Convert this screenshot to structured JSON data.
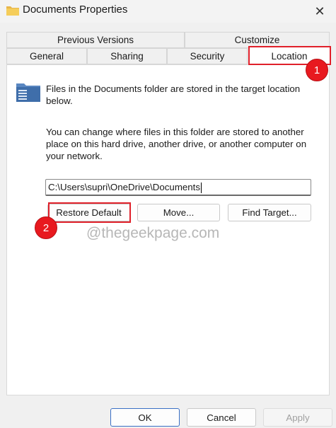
{
  "window": {
    "title": "Documents Properties",
    "close_glyph": "✕",
    "title_icon": "folder-icon"
  },
  "tabs": {
    "row_top": [
      {
        "label": "Previous Versions"
      },
      {
        "label": "Customize"
      }
    ],
    "row_bottom": [
      {
        "label": "General"
      },
      {
        "label": "Sharing"
      },
      {
        "label": "Security"
      },
      {
        "label": "Location",
        "selected": true
      }
    ]
  },
  "location": {
    "folder_icon": "folder-icon",
    "info_text": "Files in the Documents folder are stored in the target location below.",
    "description_text": "You can change where files in this folder are stored to another place on this hard drive, another drive, or another computer on your network.",
    "path_value": "C:\\Users\\supri\\OneDrive\\Documents",
    "restore_default_label": "Restore Default",
    "move_label": "Move...",
    "find_target_label": "Find Target..."
  },
  "annotations": {
    "badge_1": "1",
    "badge_2": "2",
    "highlight_color": "#e0202a",
    "watermark": "@thegeekpage.com"
  },
  "footer": {
    "ok_label": "OK",
    "cancel_label": "Cancel",
    "apply_label": "Apply",
    "apply_disabled": true
  }
}
